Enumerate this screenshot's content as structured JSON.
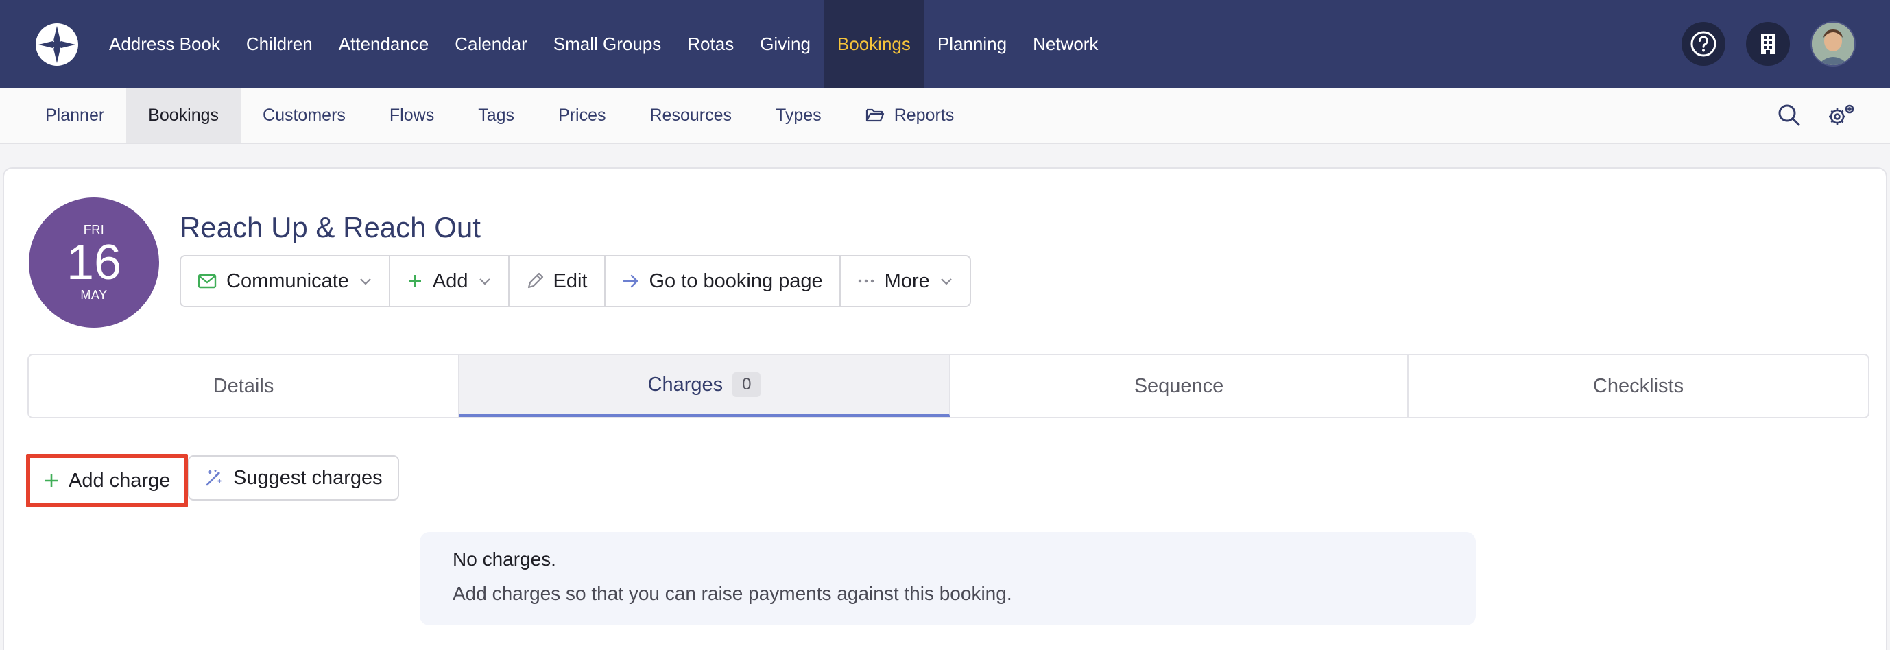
{
  "topnav": {
    "items": [
      {
        "label": "Address Book"
      },
      {
        "label": "Children"
      },
      {
        "label": "Attendance"
      },
      {
        "label": "Calendar"
      },
      {
        "label": "Small Groups"
      },
      {
        "label": "Rotas"
      },
      {
        "label": "Giving"
      },
      {
        "label": "Bookings",
        "active": true
      },
      {
        "label": "Planning"
      },
      {
        "label": "Network"
      }
    ],
    "icons": [
      "logo-icon",
      "help-icon",
      "building-icon",
      "user-avatar"
    ]
  },
  "subnav": {
    "items": [
      {
        "label": "Planner"
      },
      {
        "label": "Bookings",
        "active": true
      },
      {
        "label": "Customers"
      },
      {
        "label": "Flows"
      },
      {
        "label": "Tags"
      },
      {
        "label": "Prices"
      },
      {
        "label": "Resources"
      },
      {
        "label": "Types"
      },
      {
        "label": "Reports",
        "icon": "folder-open-icon"
      }
    ],
    "icons": [
      "search-icon",
      "settings-gear-icon"
    ]
  },
  "booking": {
    "date": {
      "day": "FRI",
      "num": "16",
      "month": "MAY"
    },
    "title": "Reach Up & Reach Out",
    "actions": [
      {
        "label": "Communicate",
        "icon": "envelope-icon",
        "dropdown": true
      },
      {
        "label": "Add",
        "icon": "plus-icon",
        "dropdown": true
      },
      {
        "label": "Edit",
        "icon": "pencil-icon"
      },
      {
        "label": "Go to booking page",
        "icon": "arrow-right-icon"
      },
      {
        "label": "More",
        "icon": "ellipsis-icon",
        "dropdown": true
      }
    ]
  },
  "tabs": [
    {
      "label": "Details"
    },
    {
      "label": "Charges",
      "count": "0",
      "active": true
    },
    {
      "label": "Sequence"
    },
    {
      "label": "Checklists"
    }
  ],
  "charges": {
    "add_label": "Add charge",
    "suggest_label": "Suggest charges",
    "empty_title": "No charges.",
    "empty_text": "Add charges so that you can raise payments against this booking."
  },
  "colors": {
    "nav_bg": "#333c6b",
    "nav_active": "#f5c33b",
    "date_badge": "#6e4f96",
    "highlight": "#e5412d",
    "plus_green": "#3fae57"
  }
}
